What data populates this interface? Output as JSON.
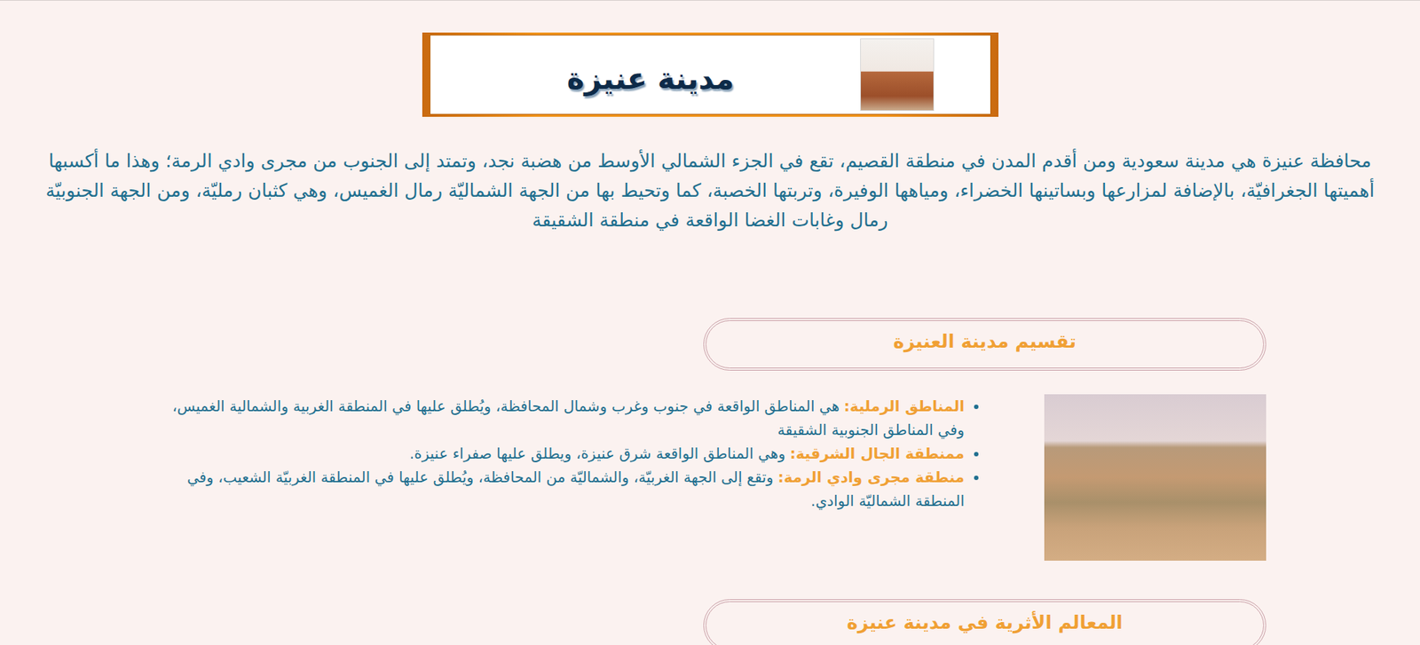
{
  "banner": {
    "title": "مدينة عنيزة"
  },
  "intro": "محافظة عنيزة هي مدينة سعودية ومن أقدم المدن في منطقة القصيم، تقع في الجزء الشمالي الأوسط من هضبة نجد، وتمتد إلى الجنوب من مجرى وادي الرمة؛ وهذا ما أكسبها أهميتها الجغرافيّة، بالإضافة لمزارعها وبساتينها الخضراء، ومياهها الوفيرة، وتربتها الخصبة، كما وتحيط بها من الجهة الشماليّة رمال الغميس، وهي كثبان رمليّة، ومن الجهة الجنوبيّة رمال وغابات الغضا الواقعة في منطقة الشقيقة",
  "sections": [
    {
      "heading": "تقسيم مدينة العنيزة",
      "items": [
        {
          "label": "المناطق الرملية:",
          "text": "هي المناطق الواقعة في جنوب وغرب وشمال المحافظة، ويُطلق عليها في المنطقة الغربية والشمالية الغميس، وفي المناطق الجنوبية الشقيقة"
        },
        {
          "label": "ممنطقة الجال الشرقية:",
          "text": "وهي المناطق الواقعة شرق عنيزة، ويطلق عليها صفراء عنيزة."
        },
        {
          "label": "منطقة مجرى وادي الرمة:",
          "text": "وتقع إلى الجهة الغربيّة، والشماليّة من المحافظة، ويُطلق عليها في المنطقة الغربيّة الشعيب، وفي المنطقة الشماليّة الوادي."
        }
      ]
    },
    {
      "heading": "المعالم الأثرية في مدينة عنيزة",
      "items": []
    }
  ]
}
